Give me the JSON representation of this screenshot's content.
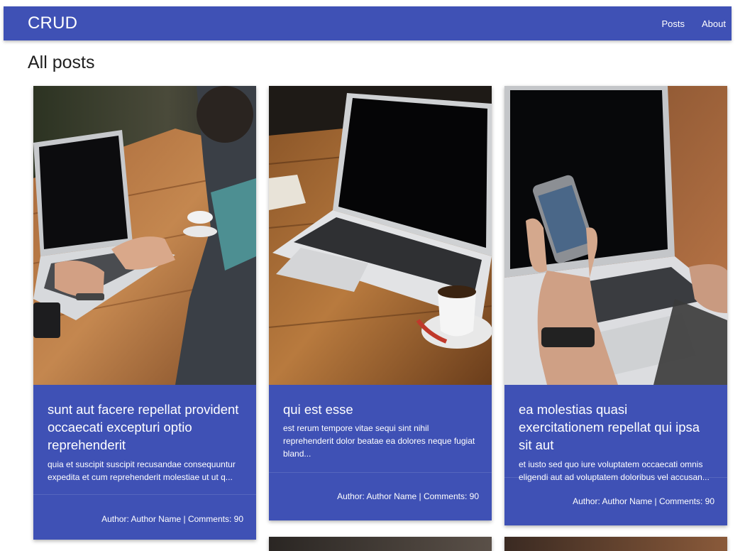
{
  "navbar": {
    "brand": "CRUD",
    "links": [
      "Posts",
      "About"
    ],
    "background": "#3f51b5"
  },
  "page": {
    "title": "All posts"
  },
  "posts": [
    {
      "title": "sunt aut facere repellat provident occaecati excepturi optio reprehenderit",
      "excerpt": "quia et suscipit suscipit recusandae consequuntur expedita et cum reprehenderit molestiae ut ut q...",
      "footer": "Author: Author Name | Comments: 90",
      "image": "person typing on laptop at wooden table"
    },
    {
      "title": "qui est esse",
      "excerpt": "est rerum tempore vitae sequi sint nihil reprehenderit dolor beatae ea dolores neque fugiat bland...",
      "footer": "Author: Author Name | Comments: 90",
      "image": "laptop with coffee cup on wooden table"
    },
    {
      "title": "ea molestias quasi exercitationem repellat qui ipsa sit aut",
      "excerpt": "et iusto sed quo iure voluptatem occaecati omnis eligendi aut ad voluptatem doloribus vel accusan...",
      "footer": "Author: Author Name | Comments: 90",
      "image": "hand holding smartphone in front of laptop"
    }
  ],
  "colors": {
    "card": "#3f51b5",
    "title_text": "#212121"
  }
}
